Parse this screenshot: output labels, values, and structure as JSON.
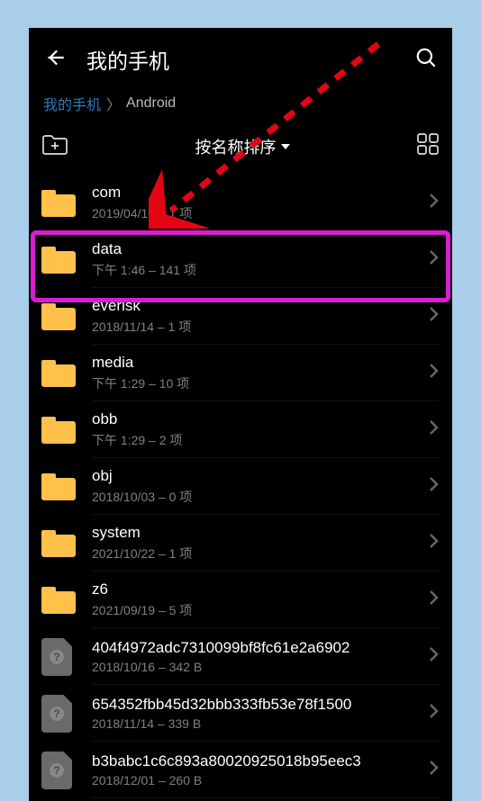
{
  "header": {
    "title": "我的手机"
  },
  "breadcrumb": {
    "root": "我的手机",
    "current": "Android"
  },
  "toolbar": {
    "sort_label": "按名称排序"
  },
  "list": [
    {
      "type": "folder",
      "name": "com",
      "meta": "2019/04/10 – 1 项"
    },
    {
      "type": "folder",
      "name": "data",
      "meta": "下午 1:46  – 141 项",
      "highlighted": true
    },
    {
      "type": "folder",
      "name": "everisk",
      "meta": "2018/11/14 – 1 项"
    },
    {
      "type": "folder",
      "name": "media",
      "meta": "下午 1:29  – 10 项"
    },
    {
      "type": "folder",
      "name": "obb",
      "meta": "下午 1:29  – 2 项"
    },
    {
      "type": "folder",
      "name": "obj",
      "meta": "2018/10/03 – 0 项"
    },
    {
      "type": "folder",
      "name": "system",
      "meta": "2021/10/22 – 1 项"
    },
    {
      "type": "folder",
      "name": "z6",
      "meta": "2021/09/19 – 5 项"
    },
    {
      "type": "file",
      "name": "404f4972adc7310099bf8fc61e2a6902",
      "meta": "2018/10/16 – 342 B"
    },
    {
      "type": "file",
      "name": "654352fbb45d32bbb333fb53e78f1500",
      "meta": "2018/11/14 – 339 B"
    },
    {
      "type": "file",
      "name": "b3babc1c6c893a80020925018b95eec3",
      "meta": "2018/12/01 – 260 B"
    }
  ]
}
